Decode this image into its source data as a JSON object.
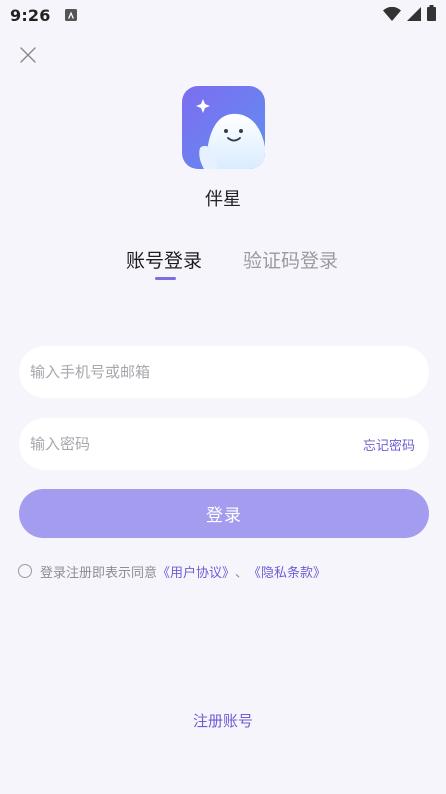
{
  "status_bar": {
    "time": "9:26",
    "notification_icon": "app-notification-icon",
    "wifi_icon": "wifi-icon",
    "signal_icon": "cell-signal-icon",
    "battery_icon": "battery-icon"
  },
  "close_icon": "close-icon",
  "app": {
    "logo_icon": "ghost-mascot-icon",
    "name": "伴星"
  },
  "tabs": [
    {
      "label": "账号登录",
      "active": true
    },
    {
      "label": "验证码登录",
      "active": false
    }
  ],
  "form": {
    "account_placeholder": "输入手机号或邮箱",
    "account_value": "",
    "password_placeholder": "输入密码",
    "password_value": "",
    "forgot_password": "忘记密码",
    "login_button": "登录"
  },
  "agreement": {
    "checked": false,
    "prefix": "登录注册即表示同意",
    "user_agreement": "《用户协议》",
    "separator": "、",
    "privacy_policy": "《隐私条款》"
  },
  "register_link": "注册账号",
  "colors": {
    "accent": "#6b5fd3",
    "button": "#a49cee",
    "background": "#f7f5fc"
  }
}
